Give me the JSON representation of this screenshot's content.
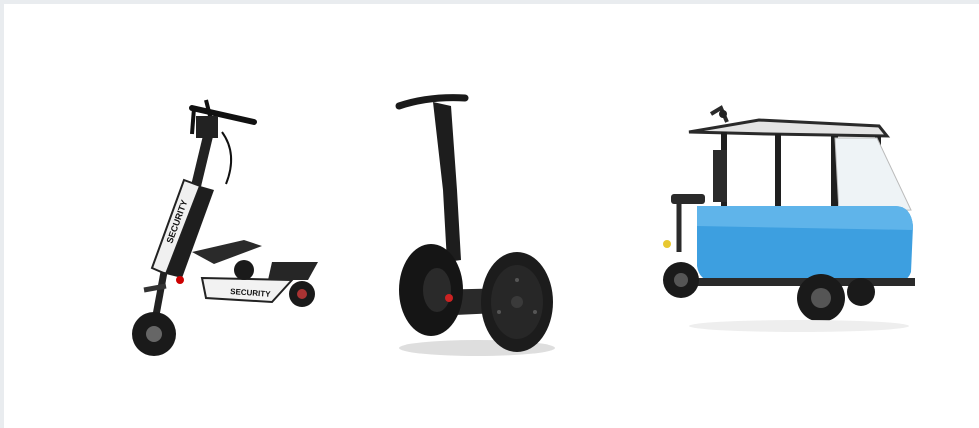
{
  "image": {
    "scene": "three-personal-electric-vehicles",
    "background_color": "#ffffff",
    "border_color": "#e9ecef"
  },
  "vehicles": [
    {
      "name": "three-wheel-scooter",
      "printed_text": [
        "SECURITY",
        "SECURITY"
      ],
      "color": "#eeeeee"
    },
    {
      "name": "segway",
      "printed_text": [],
      "color": "#1c1c1c"
    },
    {
      "name": "covered-electric-cart",
      "printed_text": [],
      "color": "#3d9fe0"
    }
  ]
}
